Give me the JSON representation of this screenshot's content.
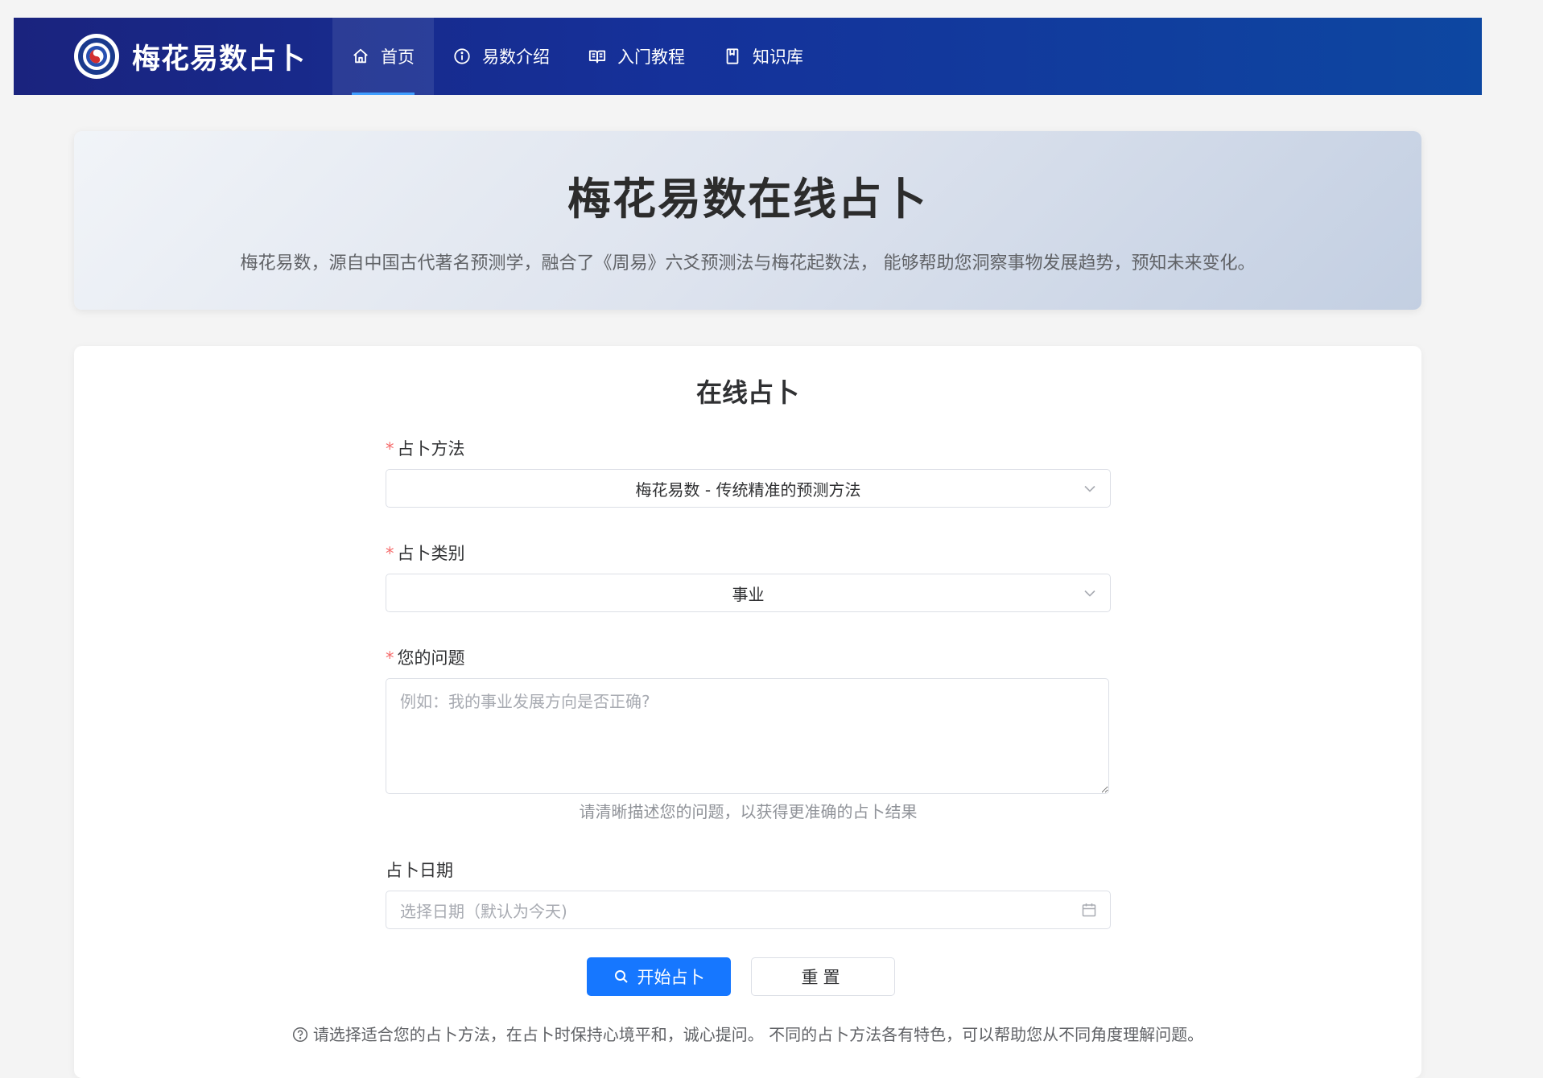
{
  "header": {
    "logo_text": "梅花易数占卜",
    "nav": [
      {
        "label": "首页",
        "icon": "home-icon",
        "active": true
      },
      {
        "label": "易数介绍",
        "icon": "info-icon",
        "active": false
      },
      {
        "label": "入门教程",
        "icon": "book-icon",
        "active": false
      },
      {
        "label": "知识库",
        "icon": "bookmark-icon",
        "active": false
      }
    ]
  },
  "hero": {
    "title": "梅花易数在线占卜",
    "description": "梅花易数，源自中国古代著名预测学，融合了《周易》六爻预测法与梅花起数法， 能够帮助您洞察事物发展趋势，预知未来变化。"
  },
  "form": {
    "title": "在线占卜",
    "method": {
      "label": "占卜方法",
      "required": "*",
      "value": "梅花易数 - 传统精准的预测方法"
    },
    "category": {
      "label": "占卜类别",
      "required": "*",
      "value": "事业"
    },
    "question": {
      "label": "您的问题",
      "required": "*",
      "value": "",
      "placeholder": "例如：我的事业发展方向是否正确?",
      "hint": "请清晰描述您的问题，以获得更准确的占卜结果"
    },
    "date": {
      "label": "占卜日期",
      "placeholder": "选择日期（默认为今天)"
    },
    "buttons": {
      "submit": "开始占卜",
      "reset": "重置"
    },
    "footnote": "请选择适合您的占卜方法，在占卜时保持心境平和，诚心提问。 不同的占卜方法各有特色，可以帮助您从不同角度理解问题。"
  },
  "colors": {
    "header_gradient_start": "#1a237e",
    "header_gradient_end": "#0d47a1",
    "primary": "#1677ff",
    "required": "#f56c6c",
    "active_underline": "#409eff"
  }
}
